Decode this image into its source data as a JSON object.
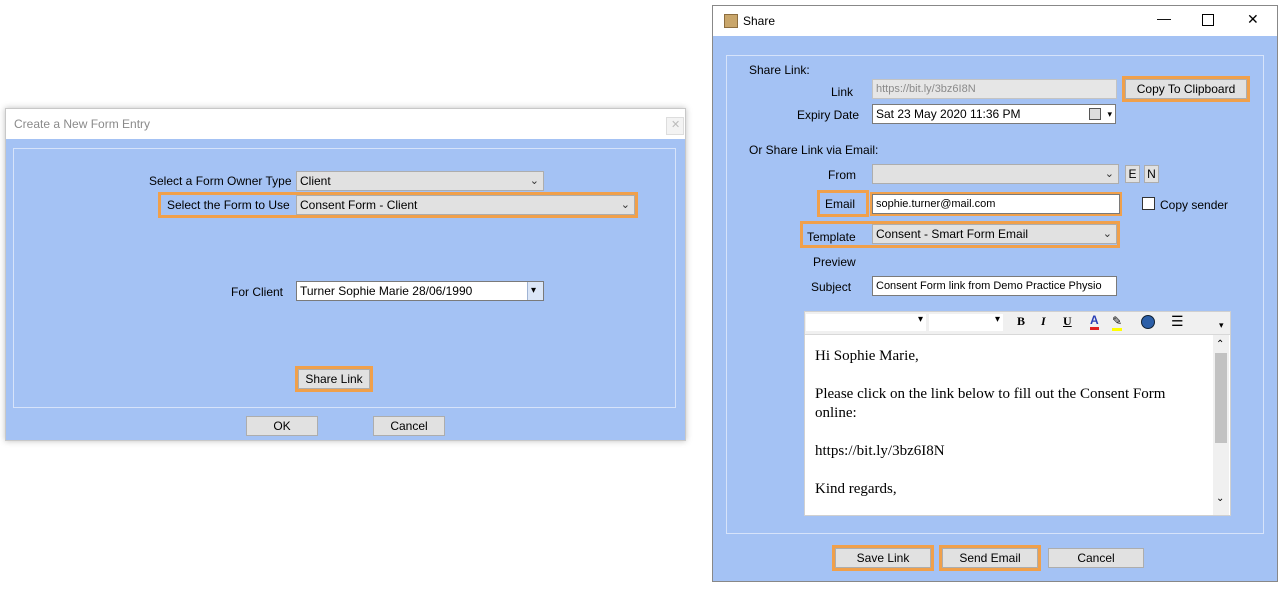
{
  "form_dialog": {
    "title": "Create a New Form Entry",
    "owner_type_label": "Select a Form Owner Type",
    "owner_type_value": "Client",
    "form_label": "Select the Form to Use",
    "form_value": "Consent Form - Client",
    "client_label": "For Client",
    "client_value": "Turner Sophie Marie 28/06/1990",
    "share_link_label": "Share Link",
    "ok_label": "OK",
    "cancel_label": "Cancel"
  },
  "share_dialog": {
    "title": "Share",
    "share_link_heading": "Share Link:",
    "link_label": "Link",
    "link_value": "https://bit.ly/3bz6I8N",
    "copy_label": "Copy To Clipboard",
    "expiry_label": "Expiry Date",
    "expiry_value": "Sat  23 May 2020 11:36 PM",
    "email_heading": "Or Share Link via Email:",
    "from_label": "From",
    "from_value": "",
    "e_label": "E",
    "n_label": "N",
    "email_label": "Email",
    "email_value": "sophie.turner@mail.com",
    "copy_sender_label": "Copy sender",
    "template_label": "Template",
    "template_value": "Consent - Smart Form Email",
    "preview_label": "Preview",
    "subject_label": "Subject",
    "subject_value": "Consent Form link from Demo Practice Physio",
    "editor": {
      "bold": "B",
      "italic": "I",
      "underline": "U",
      "font_color": "A",
      "lines": [
        "Hi Sophie Marie,",
        "Please click on the link below to fill out the Consent Form",
        "online:",
        "https://bit.ly/3bz6I8N",
        "Kind regards,"
      ]
    },
    "save_link_label": "Save Link",
    "send_email_label": "Send Email",
    "cancel_label": "Cancel"
  },
  "colors": {
    "dialog_bg": "#a4c2f4",
    "highlight": "#f0a04b",
    "button_bg": "#e1e1e1"
  }
}
